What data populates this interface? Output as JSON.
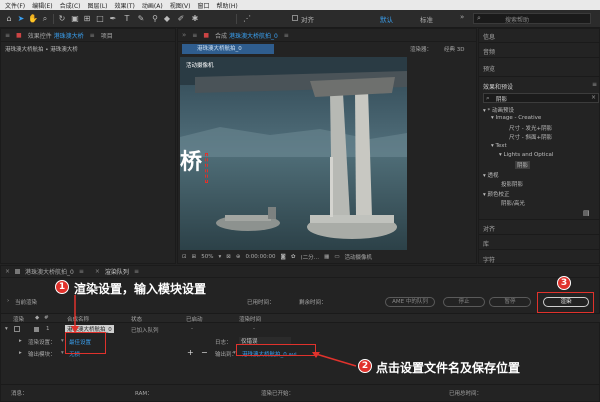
{
  "menu": [
    "文件(F)",
    "编辑(E)",
    "合成(C)",
    "图层(L)",
    "效果(T)",
    "动画(A)",
    "视图(V)",
    "窗口",
    "帮助(H)"
  ],
  "toolbar": {
    "align_label": "对齐",
    "workspace_default": "默认",
    "workspace_standard": "标准",
    "workspace_more": "»",
    "search_placeholder": "搜索帮助"
  },
  "project_panel": {
    "tab_prefix": "效果控件",
    "tab_comp": "港珠澳大桥",
    "tab_project": "项目",
    "breadcrumb": "港珠澳大桥航拍 • 港珠澳大桥"
  },
  "comp_panel": {
    "tab_prefix": "合成",
    "tab_name": "港珠澳大桥航拍_0",
    "crumb": "港珠澳大桥航拍_0",
    "renderer_label": "渲染器：",
    "renderer_value": "经典 3D",
    "video_overlay_text": "活动摄像机",
    "big_char": "桥",
    "zoom": "50%",
    "timecode": "0:00:00:00",
    "resolution": "(二分…",
    "camera": "活动摄像机"
  },
  "right_panel": {
    "items": [
      "信息",
      "音频",
      "预览"
    ],
    "effects_title": "效果和预设",
    "search_value": "阴影",
    "tree": [
      "▾ * 动画预设",
      "▾ Image - Creative",
      "尺寸 - 发光+阴影",
      "尺寸 - 斜面+阴影",
      "▾ Text",
      "▾ Lights and Optical",
      "阴影",
      "▾ 透视",
      "投影阴影",
      "▾ 颜色校正",
      "阴影/高光"
    ],
    "bottom_items": [
      "对齐",
      "库",
      "字符"
    ]
  },
  "bottom_tabs": {
    "comp_tab": "港珠澳大桥航拍_0",
    "render_queue_tab": "渲染队列"
  },
  "render_queue": {
    "current_render": "当前渲染",
    "elapsed_label": "已用时间：",
    "remaining_label": "剩余时间：",
    "ame_button": "AME 中的队列",
    "stop_button": "停止",
    "pause_button": "暂停",
    "render_button": "渲染",
    "headers": [
      "渲染",
      "#",
      "合成名称",
      "状态",
      "已启动",
      "渲染时间"
    ],
    "row": {
      "index": "1",
      "comp_name": "港珠澳大桥航拍_0",
      "status": "已加入队列",
      "started": "-",
      "render_time": "-"
    },
    "render_settings_label": "渲染设置：",
    "render_settings_value": "最佳设置",
    "output_module_label": "输出模块：",
    "output_module_value": "无损",
    "log_label": "日志：",
    "log_value": "仅错误",
    "output_to_label": "输出到：",
    "output_to_value": "港珠澳大桥航拍_0.avi"
  },
  "status_bar": {
    "message_label": "消息：",
    "ram_label": "RAM：",
    "renders_started_label": "渲染已开始：",
    "total_elapsed_label": "已用总时间："
  },
  "annotations": {
    "step1_number": "1",
    "step1_text": "渲染设置，输入模块设置",
    "step2_number": "2",
    "step2_text": "点击设置文件名及保存位置",
    "step3_number": "3"
  },
  "colors": {
    "annotation_red": "#e0322c",
    "link_blue": "#3aa0f0",
    "panel_bg": "#232323"
  }
}
